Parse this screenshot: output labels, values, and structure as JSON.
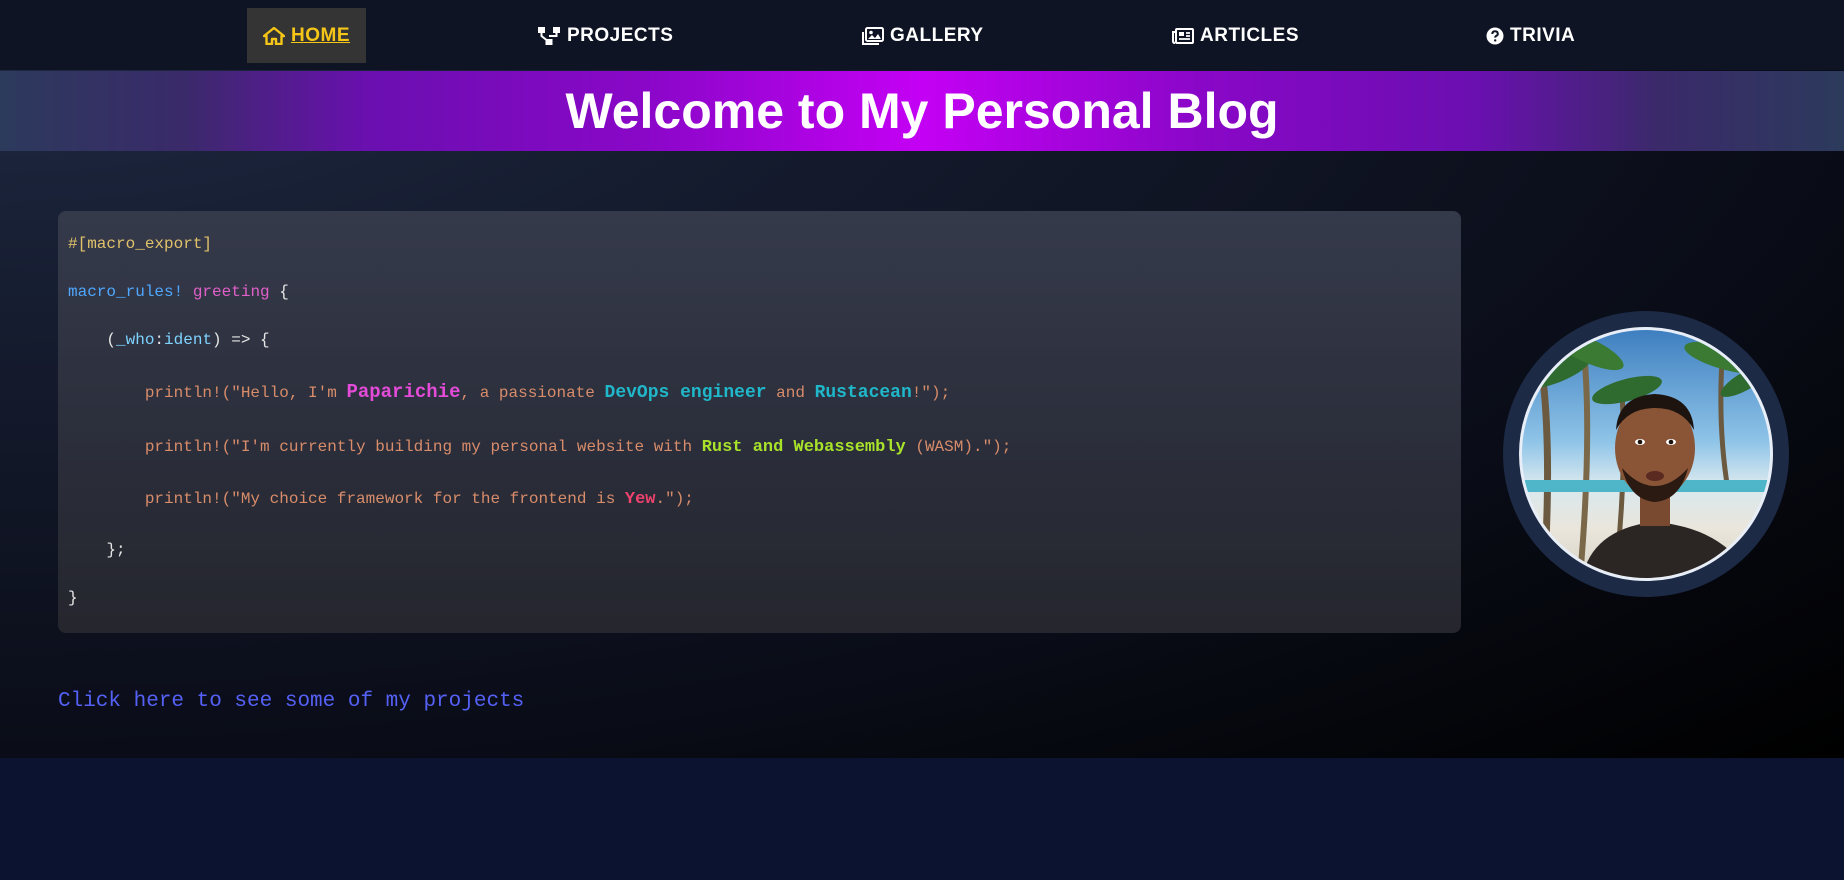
{
  "nav": {
    "items": [
      {
        "label": "HOME",
        "icon": "home-icon",
        "active": true
      },
      {
        "label": "PROJECTS",
        "icon": "sitemap-icon",
        "active": false
      },
      {
        "label": "GALLERY",
        "icon": "images-icon",
        "active": false
      },
      {
        "label": "ARTICLES",
        "icon": "newspaper-icon",
        "active": false
      },
      {
        "label": "TRIVIA",
        "icon": "question-circle-icon",
        "active": false
      }
    ],
    "active_color": "#f5c518"
  },
  "banner": {
    "title": "Welcome to My Personal Blog"
  },
  "code": {
    "attribute": "#[macro_export]",
    "macro_keyword": "macro_rules!",
    "macro_name": "greeting",
    "open_brace": " {",
    "arm_open_paren": "(",
    "arm_var": "_who",
    "arm_colon": ":",
    "arm_type": "ident",
    "arm_close": ") => {",
    "line1_prefix": "println!(\"Hello, I'm ",
    "line1_name": "Paparichie",
    "line1_mid": ", a passionate ",
    "line1_role": "DevOps engineer",
    "line1_and": " and ",
    "line1_rust": "Rustacean",
    "line1_suffix": "!\");",
    "line2_prefix": "println!(\"I'm currently building my personal website with ",
    "line2_tech": "Rust and Webassembly",
    "line2_suffix": " (WASM).\");",
    "line3_prefix": "println!(\"My choice framework for the frontend is ",
    "line3_fw": "Yew",
    "line3_suffix": ".\");",
    "arm_end": "};",
    "close": "}"
  },
  "link": {
    "text": "Click here to see some of my projects"
  },
  "colors": {
    "banner_center": "#c400f4",
    "link": "#5560f5",
    "page_bottom": "#0b1330"
  }
}
